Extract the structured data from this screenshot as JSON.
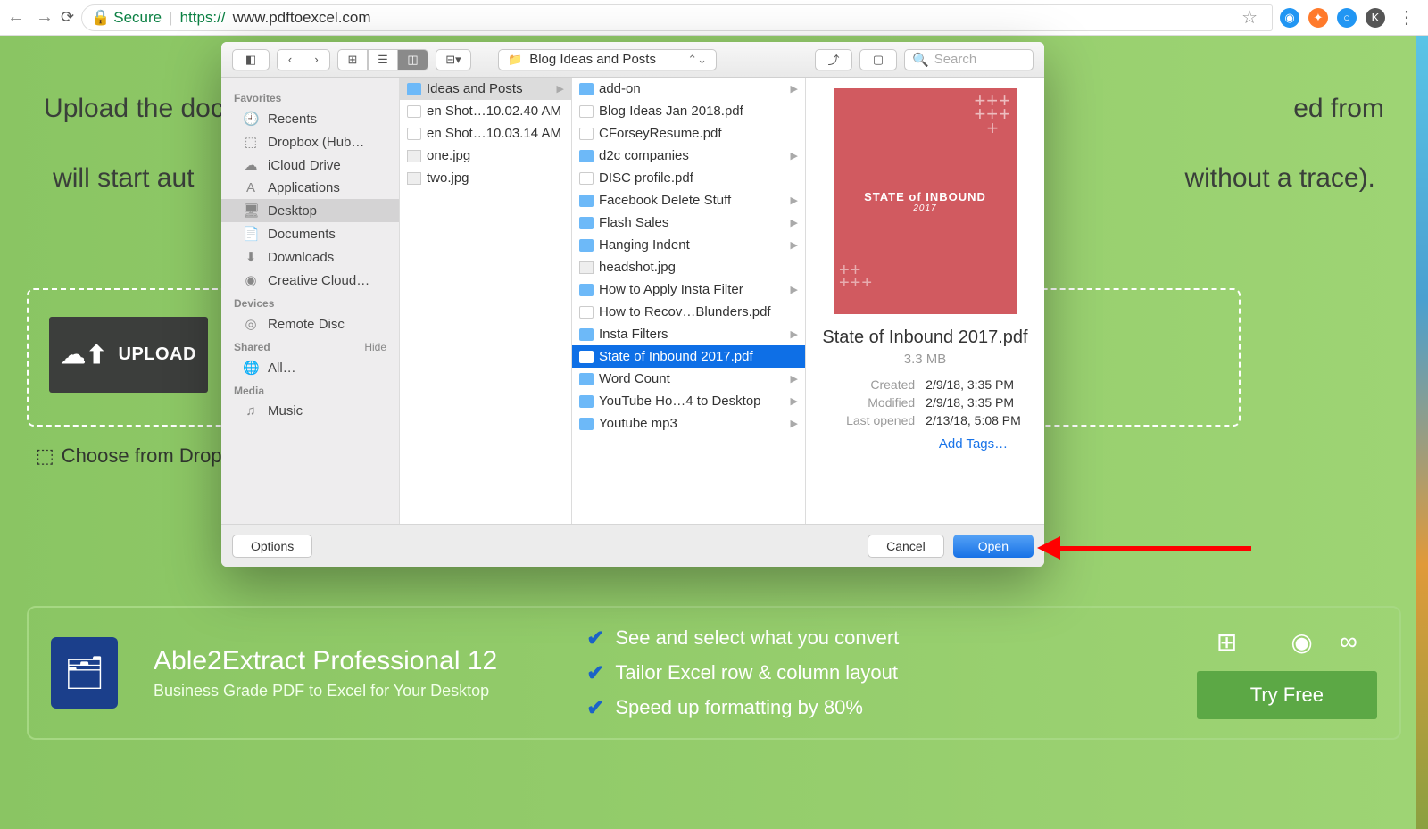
{
  "browser": {
    "secure_label": "Secure",
    "url_proto": "https://",
    "url": "www.pdftoexcel.com",
    "ext_colors": [
      "#2196f3",
      "#ff7a2b",
      "#2196f3",
      "#555"
    ],
    "ext_letters": [
      "",
      "",
      "",
      ""
    ]
  },
  "page": {
    "desc_left": "Upload the docume",
    "desc_right": "ed from our servers",
    "desc2_left": "will start aut",
    "desc2_right": "without a trace).",
    "upload_label": "UPLOAD",
    "dropbox_label": "Choose from Dropbox"
  },
  "promo": {
    "title": "Able2Extract Professional 12",
    "subtitle": "Business Grade PDF to Excel for Your Desktop",
    "features": [
      "See and select what you convert",
      "Tailor Excel row & column layout",
      "Speed up formatting by 80%"
    ],
    "cta": "Try Free"
  },
  "finder": {
    "path_label": "Blog Ideas and Posts",
    "search_placeholder": "Search",
    "sidebar": {
      "sections": [
        {
          "head": "Favorites",
          "right": "",
          "items": [
            {
              "icon": "🕘",
              "label": "Recents"
            },
            {
              "icon": "⬚",
              "label": "Dropbox (Hub…"
            },
            {
              "icon": "☁",
              "label": "iCloud Drive"
            },
            {
              "icon": "A",
              "label": "Applications"
            },
            {
              "icon": "🖥",
              "label": "Desktop",
              "sel": true
            },
            {
              "icon": "📄",
              "label": "Documents"
            },
            {
              "icon": "⬇",
              "label": "Downloads"
            },
            {
              "icon": "◉",
              "label": "Creative Cloud…"
            }
          ]
        },
        {
          "head": "Devices",
          "right": "",
          "items": [
            {
              "icon": "◎",
              "label": "Remote Disc"
            }
          ]
        },
        {
          "head": "Shared",
          "right": "Hide",
          "items": [
            {
              "icon": "🌐",
              "label": "All…"
            }
          ]
        },
        {
          "head": "Media",
          "right": "",
          "items": [
            {
              "icon": "♫",
              "label": "Music"
            }
          ]
        }
      ]
    },
    "col_a_sel": "Ideas and Posts",
    "col_a": [
      {
        "label": "en Shot…10.02.40 AM",
        "type": "pdf"
      },
      {
        "label": "en Shot…10.03.14 AM",
        "type": "pdf"
      },
      {
        "label": "one.jpg",
        "type": "jpg"
      },
      {
        "label": "two.jpg",
        "type": "jpg"
      }
    ],
    "col_b": [
      {
        "label": "add-on",
        "type": "folder",
        "chev": true
      },
      {
        "label": "Blog Ideas Jan 2018.pdf",
        "type": "pdf"
      },
      {
        "label": "CForseyResume.pdf",
        "type": "pdf"
      },
      {
        "label": "d2c companies",
        "type": "folder",
        "chev": true
      },
      {
        "label": "DISC profile.pdf",
        "type": "pdf"
      },
      {
        "label": "Facebook Delete Stuff",
        "type": "folder",
        "chev": true
      },
      {
        "label": "Flash Sales",
        "type": "folder",
        "chev": true
      },
      {
        "label": "Hanging Indent",
        "type": "folder",
        "chev": true
      },
      {
        "label": "headshot.jpg",
        "type": "jpg"
      },
      {
        "label": "How to Apply Insta Filter",
        "type": "folder",
        "chev": true
      },
      {
        "label": "How to Recov…Blunders.pdf",
        "type": "pdf"
      },
      {
        "label": "Insta Filters",
        "type": "folder",
        "chev": true
      },
      {
        "label": "State of Inbound 2017.pdf",
        "type": "pdf",
        "sel": true
      },
      {
        "label": "Word Count",
        "type": "folder",
        "chev": true
      },
      {
        "label": "YouTube Ho…4 to Desktop",
        "type": "folder",
        "chev": true
      },
      {
        "label": "Youtube mp3",
        "type": "folder",
        "chev": true
      }
    ],
    "preview": {
      "thumb_line1": "STATE of INBOUND",
      "thumb_line2": "2017",
      "name": "State of Inbound 2017.pdf",
      "size": "3.3 MB",
      "meta": [
        {
          "k": "Created",
          "v": "2/9/18, 3:35 PM"
        },
        {
          "k": "Modified",
          "v": "2/9/18, 3:35 PM"
        },
        {
          "k": "Last opened",
          "v": "2/13/18, 5:08 PM"
        }
      ],
      "add_tags": "Add Tags…"
    },
    "footer": {
      "options": "Options",
      "cancel": "Cancel",
      "open": "Open"
    }
  }
}
